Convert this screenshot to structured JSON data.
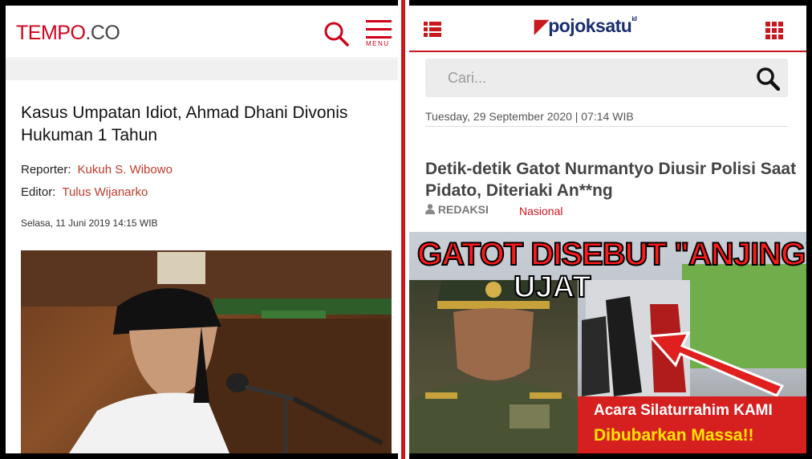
{
  "left": {
    "logo": {
      "main": "TEMPO",
      "suffix": ".CO"
    },
    "menu_label": "MENU",
    "article": {
      "title": "Kasus Umpatan Idiot, Ahmad Dhani Divonis Hukuman 1 Tahun",
      "reporter_label": "Reporter:",
      "reporter": "Kukuh S. Wibowo",
      "editor_label": "Editor:",
      "editor": "Tulus Wijanarko",
      "date": "Selasa, 11 Juni 2019 14:15 WIB"
    }
  },
  "right": {
    "logo": {
      "main": "pojoksatu",
      "suffix": "id"
    },
    "search": {
      "placeholder": "Cari..."
    },
    "date": "Tuesday, 29 September 2020 | 07:14 WIB",
    "article": {
      "title": "Detik-detik Gatot Nurmantyo Diusir Polisi Saat Pidato, Diteriaki An**ng",
      "author": "REDAKSI",
      "category": "Nasional"
    },
    "image_text": {
      "headline": "GATOT DISEBUT \"ANJING\"",
      "subheadline": "UJAT",
      "caption_line1": "Acara Silaturrahim KAMI",
      "caption_line2": "Dibubarkan Massa!!"
    }
  },
  "colors": {
    "tempo_red": "#d0021b",
    "pojok_red": "#c8181e",
    "pojok_navy": "#1b2f6e"
  }
}
